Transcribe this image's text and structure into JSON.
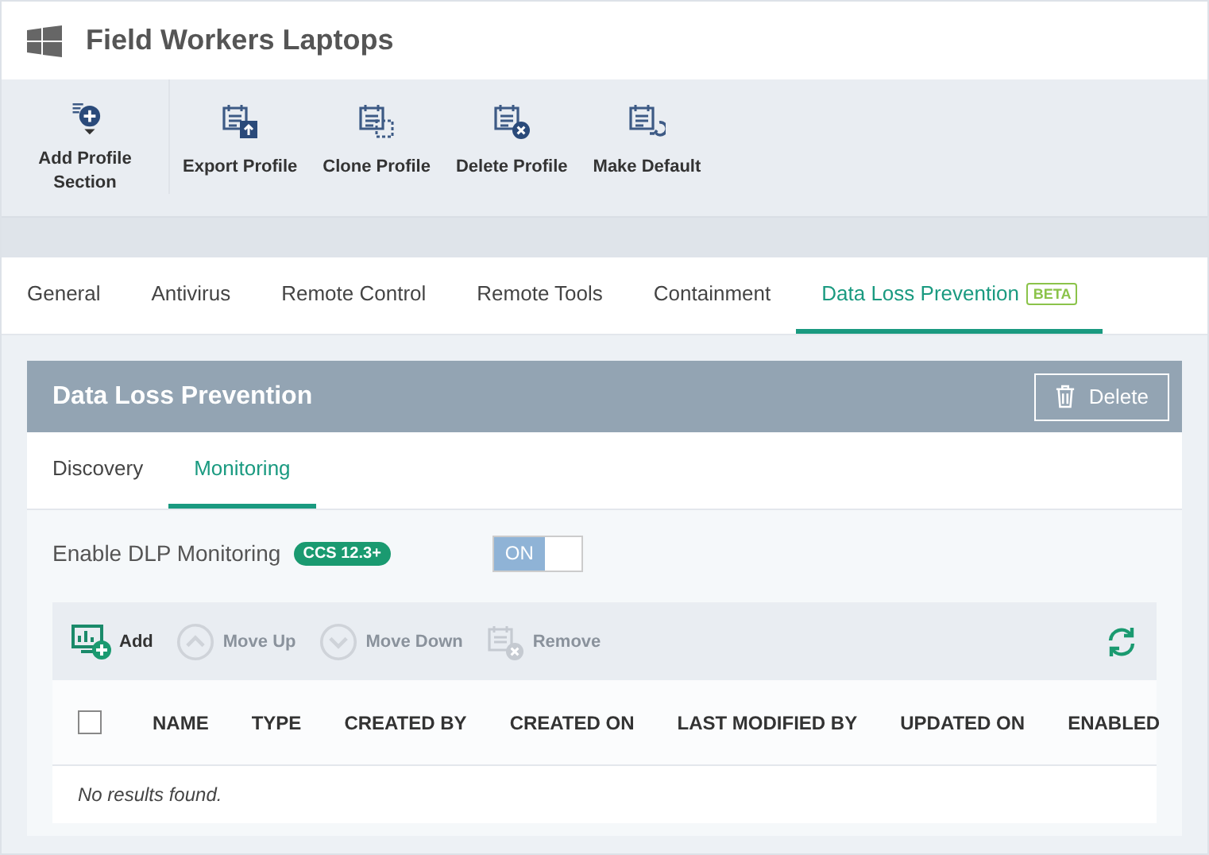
{
  "header": {
    "title": "Field Workers Laptops"
  },
  "toolbar": [
    {
      "label": "Add Profile Section"
    },
    {
      "label": "Export Profile"
    },
    {
      "label": "Clone Profile"
    },
    {
      "label": "Delete Profile"
    },
    {
      "label": "Make Default"
    }
  ],
  "tabs": [
    {
      "label": "General",
      "selected": false
    },
    {
      "label": "Antivirus",
      "selected": false
    },
    {
      "label": "Remote Control",
      "selected": false
    },
    {
      "label": "Remote Tools",
      "selected": false
    },
    {
      "label": "Containment",
      "selected": false
    },
    {
      "label": "Data Loss Prevention",
      "selected": true,
      "badge": "BETA"
    }
  ],
  "panel": {
    "title": "Data Loss Prevention",
    "delete_button": "Delete",
    "subtabs": [
      {
        "label": "Discovery",
        "selected": false
      },
      {
        "label": "Monitoring",
        "selected": true
      }
    ],
    "setting": {
      "label": "Enable DLP Monitoring",
      "badge": "CCS 12.3+",
      "on": true,
      "toggle_label": "ON"
    },
    "actions": [
      {
        "label": "Add",
        "disabled": false
      },
      {
        "label": "Move Up",
        "disabled": true
      },
      {
        "label": "Move Down",
        "disabled": true
      },
      {
        "label": "Remove",
        "disabled": true
      }
    ],
    "table": {
      "select_all_checked": false,
      "columns": [
        "NAME",
        "TYPE",
        "CREATED BY",
        "CREATED ON",
        "LAST MODIFIED BY",
        "UPDATED ON",
        "ENABLED"
      ],
      "empty_message": "No results found."
    }
  }
}
